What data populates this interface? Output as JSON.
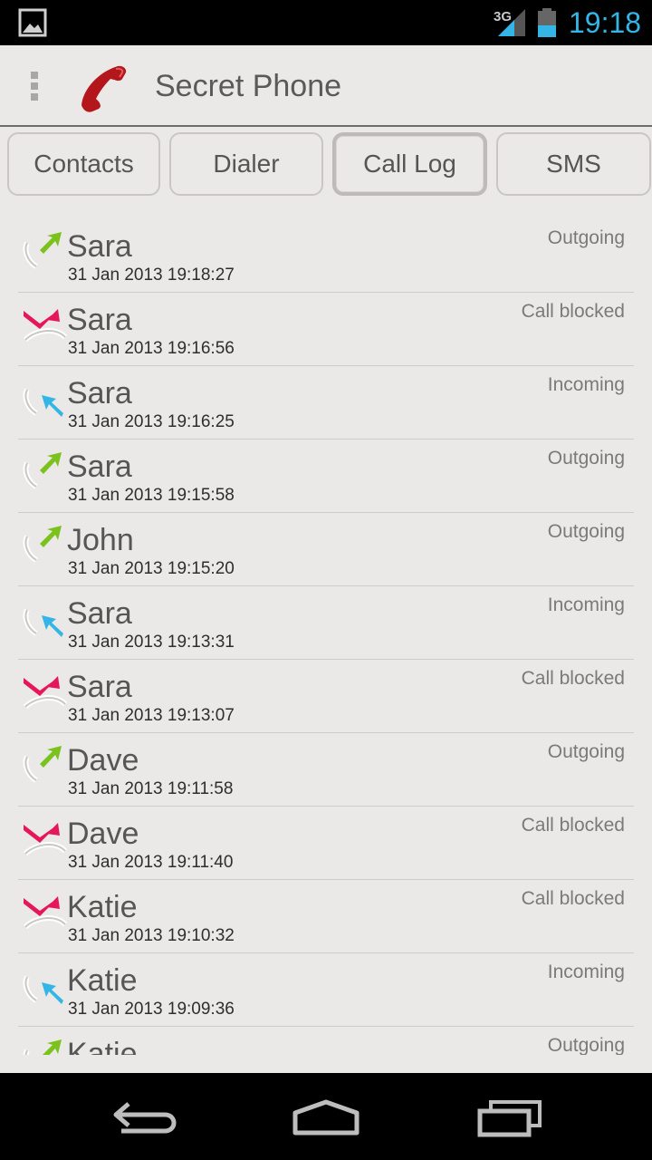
{
  "status_bar": {
    "network": "3G",
    "time": "19:18"
  },
  "action_bar": {
    "title": "Secret Phone"
  },
  "tabs": [
    {
      "label": "Contacts",
      "active": false
    },
    {
      "label": "Dialer",
      "active": false
    },
    {
      "label": "Call Log",
      "active": true
    },
    {
      "label": "SMS",
      "active": false
    }
  ],
  "calls": [
    {
      "name": "Sara",
      "datetime": "31 Jan 2013 19:18:27",
      "type": "Outgoing"
    },
    {
      "name": "Sara",
      "datetime": "31 Jan 2013 19:16:56",
      "type": "Call blocked"
    },
    {
      "name": "Sara",
      "datetime": "31 Jan 2013 19:16:25",
      "type": "Incoming"
    },
    {
      "name": "Sara",
      "datetime": "31 Jan 2013 19:15:58",
      "type": "Outgoing"
    },
    {
      "name": "John",
      "datetime": "31 Jan 2013 19:15:20",
      "type": "Outgoing"
    },
    {
      "name": "Sara",
      "datetime": "31 Jan 2013 19:13:31",
      "type": "Incoming"
    },
    {
      "name": "Sara",
      "datetime": "31 Jan 2013 19:13:07",
      "type": "Call blocked"
    },
    {
      "name": "Dave",
      "datetime": "31 Jan 2013 19:11:58",
      "type": "Outgoing"
    },
    {
      "name": "Dave",
      "datetime": "31 Jan 2013 19:11:40",
      "type": "Call blocked"
    },
    {
      "name": "Katie",
      "datetime": "31 Jan 2013 19:10:32",
      "type": "Call blocked"
    },
    {
      "name": "Katie",
      "datetime": "31 Jan 2013 19:09:36",
      "type": "Incoming"
    },
    {
      "name": "Katie",
      "datetime": "",
      "type": "Outgoing"
    }
  ],
  "colors": {
    "clock": "#33b5e5",
    "outgoing_arrow": "#7cc21e",
    "incoming_arrow": "#33b5e5",
    "blocked_arrow": "#e5175a",
    "app_icon": "#b3161b"
  },
  "icons": {
    "status_left": "gallery-icon",
    "outgoing": "outgoing-call-icon",
    "incoming": "incoming-call-icon",
    "blocked": "blocked-call-icon"
  }
}
